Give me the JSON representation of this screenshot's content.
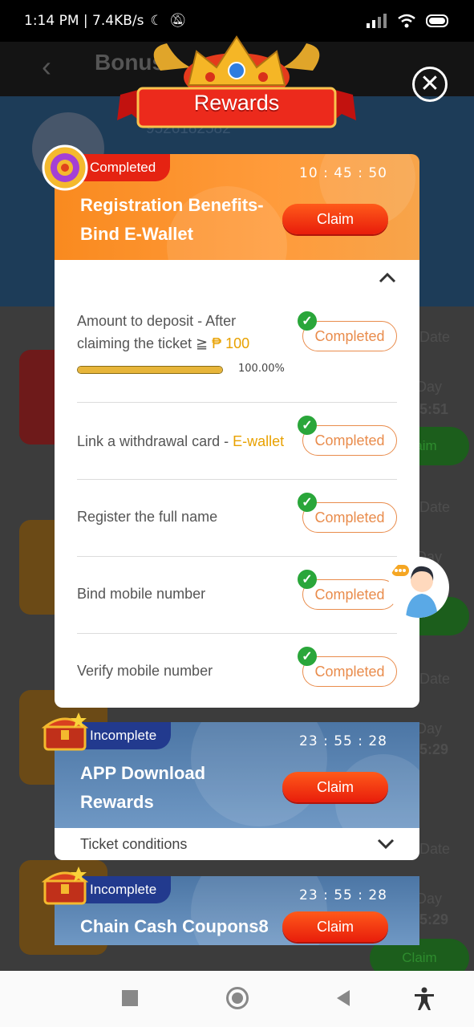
{
  "status_bar": {
    "time_speed": "1:14 PM | 7.4KB/s",
    "battery_icon": "battery-icon"
  },
  "background": {
    "title": "Bonus",
    "user_id": "9526182582",
    "date_labels": [
      "Date",
      "Date",
      "Date",
      "Date"
    ],
    "day_labels": [
      "Day",
      "Day",
      "Day",
      "Day"
    ],
    "time_values": [
      "5:51",
      "5:29",
      "5:29"
    ],
    "claim_labels": [
      "Claim",
      "Claim"
    ]
  },
  "modal": {
    "banner_title": "Rewards",
    "close_icon": "close-icon",
    "cards": [
      {
        "status": "Completed",
        "timer": "10 : 45 : 50",
        "title_line1": "Registration Benefits-",
        "title_line2": "Bind E-Wallet",
        "claim_label": "Claim",
        "tasks": [
          {
            "text1": "Amount to deposit - After",
            "text2": "claiming the ticket ≧ ",
            "highlight": "₱ 100",
            "status": "Completed",
            "progress": 100,
            "progress_label": "100.00%"
          },
          {
            "text1": "Link a withdrawal card - ",
            "highlight": "E-wallet",
            "status": "Completed"
          },
          {
            "text1": "Register the full name",
            "status": "Completed"
          },
          {
            "text1": "Bind mobile number",
            "status": "Completed"
          },
          {
            "text1": "Verify mobile number",
            "status": "Completed"
          }
        ]
      },
      {
        "status": "Incomplete",
        "timer": "23 : 55 : 28",
        "title_line1": "APP Download",
        "title_line2": "Rewards",
        "claim_label": "Claim",
        "ticket_conditions": "Ticket conditions"
      },
      {
        "status": "Incomplete",
        "timer": "23 : 55 : 28",
        "title_line1": "Chain Cash Coupons8",
        "claim_label": "Claim"
      }
    ]
  },
  "colors": {
    "accent_orange": "#f98a1f",
    "claim_red": "#e81d0b",
    "completed_text": "#e98c4c",
    "check_green": "#2aa63a",
    "highlight": "#e8a100"
  }
}
